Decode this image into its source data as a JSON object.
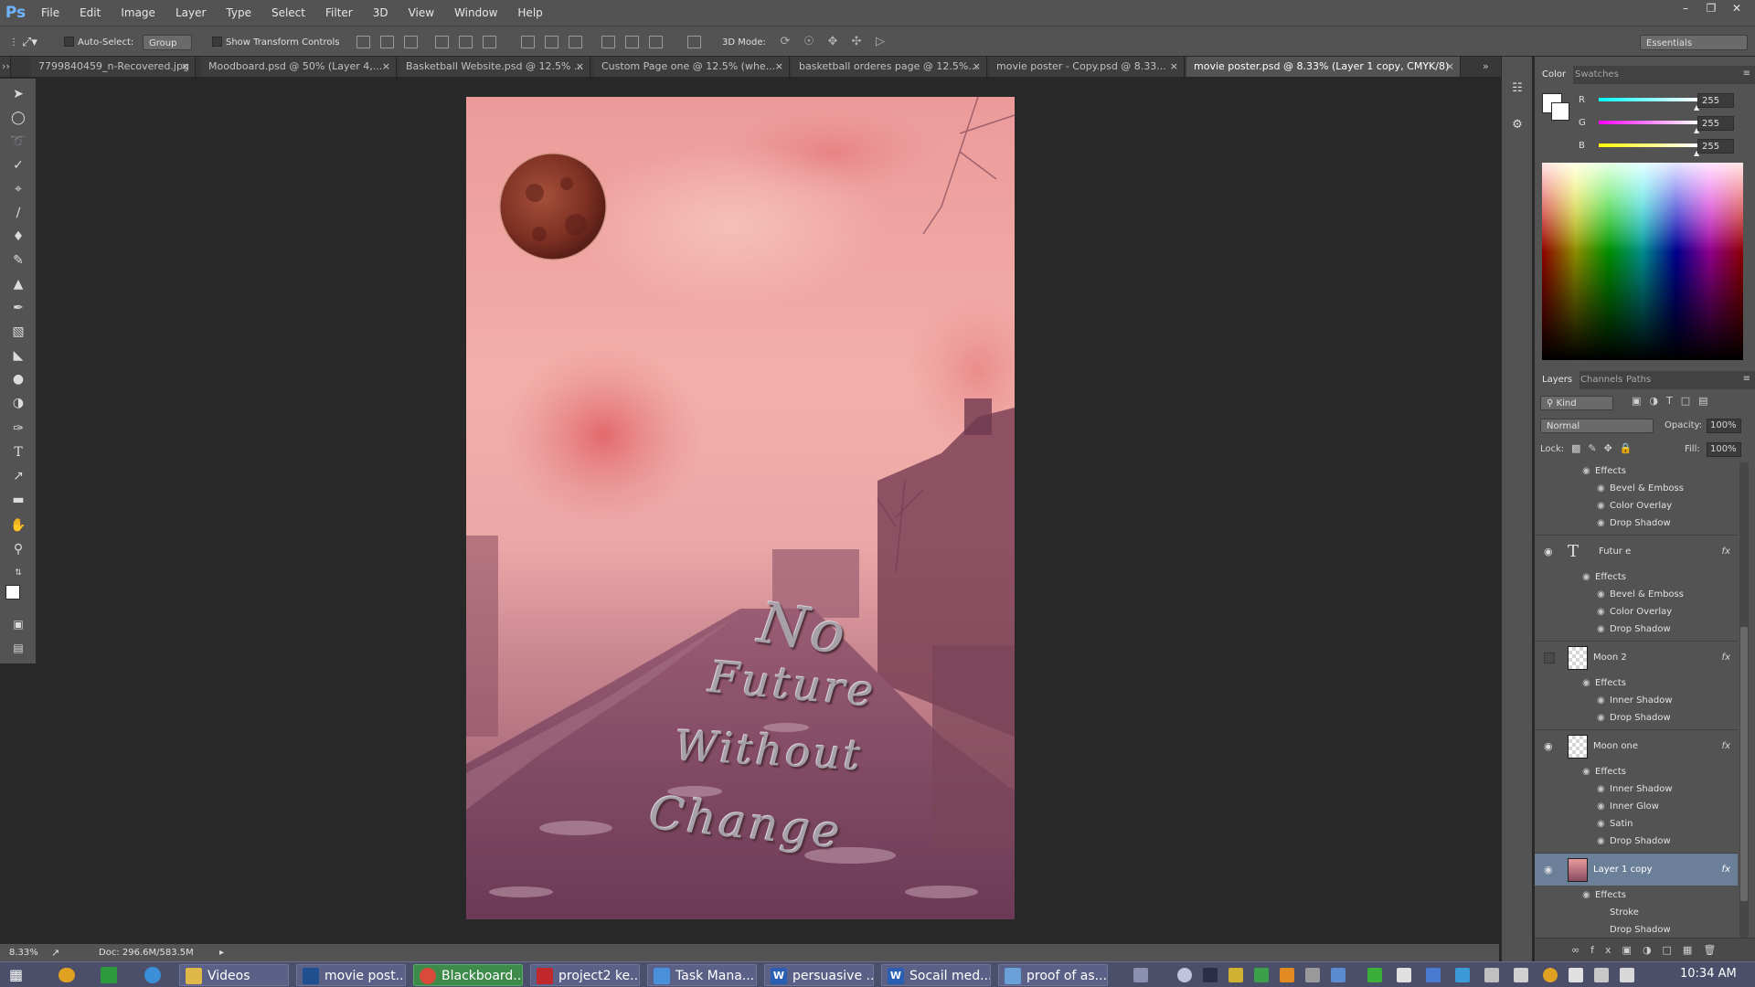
{
  "app": {
    "logo": "Ps"
  },
  "menu": [
    "File",
    "Edit",
    "Image",
    "Layer",
    "Type",
    "Select",
    "Filter",
    "3D",
    "View",
    "Window",
    "Help"
  ],
  "window_controls": [
    "minimize-icon",
    "restore-icon",
    "close-icon"
  ],
  "options": {
    "auto_select_label": "Auto-Select:",
    "auto_select_value": "Group",
    "show_transform_label": "Show Transform Controls",
    "mode_3d_label": "3D Mode:",
    "workspace": "Essentials"
  },
  "tabs": [
    {
      "label": "7799840459_n-Recovered.jpg",
      "active": false
    },
    {
      "label": "Moodboard.psd @ 50% (Layer 4,...",
      "active": false
    },
    {
      "label": "Basketball Website.psd @ 12.5% ...",
      "active": false
    },
    {
      "label": "Custom Page one @ 12.5% (whe...",
      "active": false
    },
    {
      "label": "basketball orderes page @ 12.5%...",
      "active": false
    },
    {
      "label": "movie poster - Copy.psd @ 8.33...",
      "active": false
    },
    {
      "label": "movie poster.psd @ 8.33% (Layer 1 copy, CMYK/8)",
      "active": true
    }
  ],
  "poster": {
    "line1": "No",
    "line2": "Future",
    "line3": "Without",
    "line4": "Change",
    "colors": {
      "tint": "#e88c8f",
      "road": "#7a3f55",
      "moon": "#8a3a2a"
    }
  },
  "status": {
    "zoom": "8.33%",
    "doc": "Doc: 296.6M/583.5M"
  },
  "color_panel": {
    "tabs": [
      "Color",
      "Swatches"
    ],
    "r_label": "R",
    "g_label": "G",
    "b_label": "B",
    "r": "255",
    "g": "255",
    "b": "255",
    "foreground": "#ffffff"
  },
  "layers_panel": {
    "tabs": [
      "Layers",
      "Channels",
      "Paths"
    ],
    "filter_kind": "Kind",
    "blend_mode": "Normal",
    "opacity_label": "Opacity:",
    "opacity": "100%",
    "lock_label": "Lock:",
    "fill_label": "Fill:",
    "fill": "100%",
    "top_effects": [
      "Effects",
      "Bevel & Emboss",
      "Color Overlay",
      "Drop Shadow"
    ],
    "layers": [
      {
        "name": "Futur e",
        "type": "text",
        "visible": true,
        "selected": false,
        "effects": [
          "Effects",
          "Bevel & Emboss",
          "Color Overlay",
          "Drop Shadow"
        ]
      },
      {
        "name": "Moon 2",
        "type": "image",
        "visible": false,
        "selected": false,
        "effects": [
          "Effects",
          "Inner Shadow",
          "Drop Shadow"
        ]
      },
      {
        "name": "Moon one",
        "type": "image",
        "visible": true,
        "selected": false,
        "effects": [
          "Effects",
          "Inner Shadow",
          "Inner Glow",
          "Satin",
          "Drop Shadow"
        ]
      },
      {
        "name": "Layer 1 copy",
        "type": "image",
        "visible": true,
        "selected": true,
        "effects": [
          "Effects",
          "Stroke",
          "Drop Shadow"
        ]
      }
    ]
  },
  "taskbar": {
    "buttons": [
      {
        "label": "Videos",
        "icon": "folder-icon",
        "color": "#e0b84a"
      },
      {
        "label": "movie post...",
        "icon": "photoshop-icon",
        "color": "#1f4f8f"
      },
      {
        "label": "Blackboard...",
        "icon": "chrome-icon",
        "color": "#d94a3a"
      },
      {
        "label": "project2 ke...",
        "icon": "pdf-icon",
        "color": "#c0282b"
      },
      {
        "label": "Task Mana...",
        "icon": "task-manager-icon",
        "color": "#4a8fd9"
      },
      {
        "label": "persuasive ...",
        "icon": "word-icon",
        "color": "#2b5fb3"
      },
      {
        "label": "Socail med...",
        "icon": "word-icon",
        "color": "#2b5fb3"
      },
      {
        "label": "proof of as...",
        "icon": "paint-icon",
        "color": "#6aa0d8"
      }
    ],
    "time": "10:34 AM"
  }
}
